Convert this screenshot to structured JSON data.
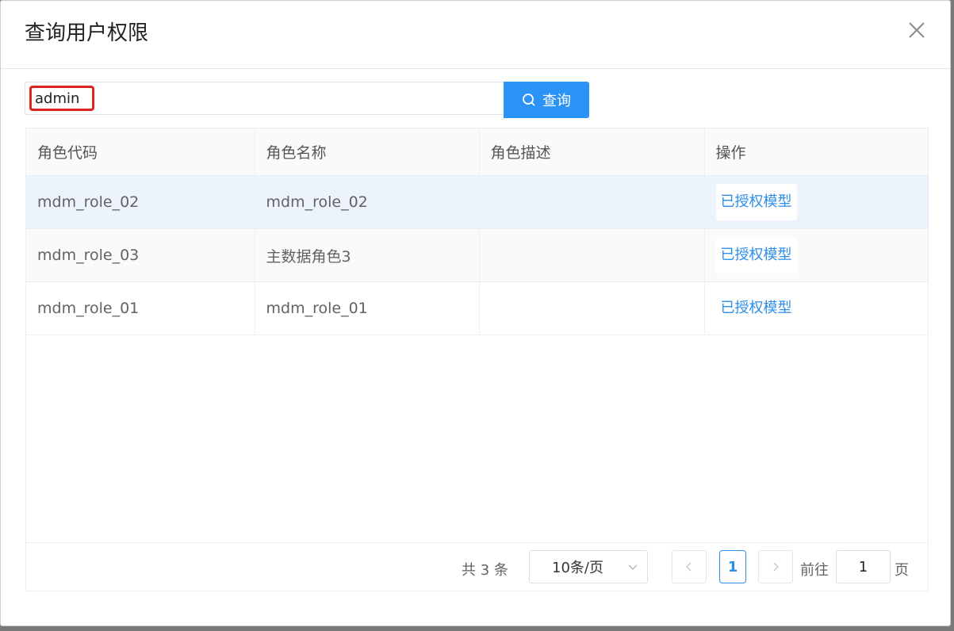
{
  "dialog": {
    "title": "查询用户权限",
    "close_icon": "close-icon"
  },
  "search": {
    "value": "admin",
    "placeholder": "",
    "button_label": "查询",
    "button_icon": "search-icon"
  },
  "table": {
    "columns": [
      "角色代码",
      "角色名称",
      "角色描述",
      "操作"
    ],
    "rows": [
      {
        "code": "mdm_role_02",
        "name": "mdm_role_02",
        "desc": "",
        "action": "已授权模型"
      },
      {
        "code": "mdm_role_03",
        "name": "主数据角色3",
        "desc": "",
        "action": "已授权模型"
      },
      {
        "code": "mdm_role_01",
        "name": "mdm_role_01",
        "desc": "",
        "action": "已授权模型"
      }
    ]
  },
  "pagination": {
    "total_text": "共 3 条",
    "page_size": "10条/页",
    "current_page": "1",
    "goto_label": "前往",
    "goto_value": "1",
    "page_suffix": "页",
    "prev_icon": "chevron-left-icon",
    "next_icon": "chevron-right-icon",
    "dropdown_icon": "chevron-down-icon"
  },
  "colors": {
    "accent": "#2b93f5",
    "highlight_border": "#e0231f",
    "selected_row": "#ecf3fd"
  }
}
